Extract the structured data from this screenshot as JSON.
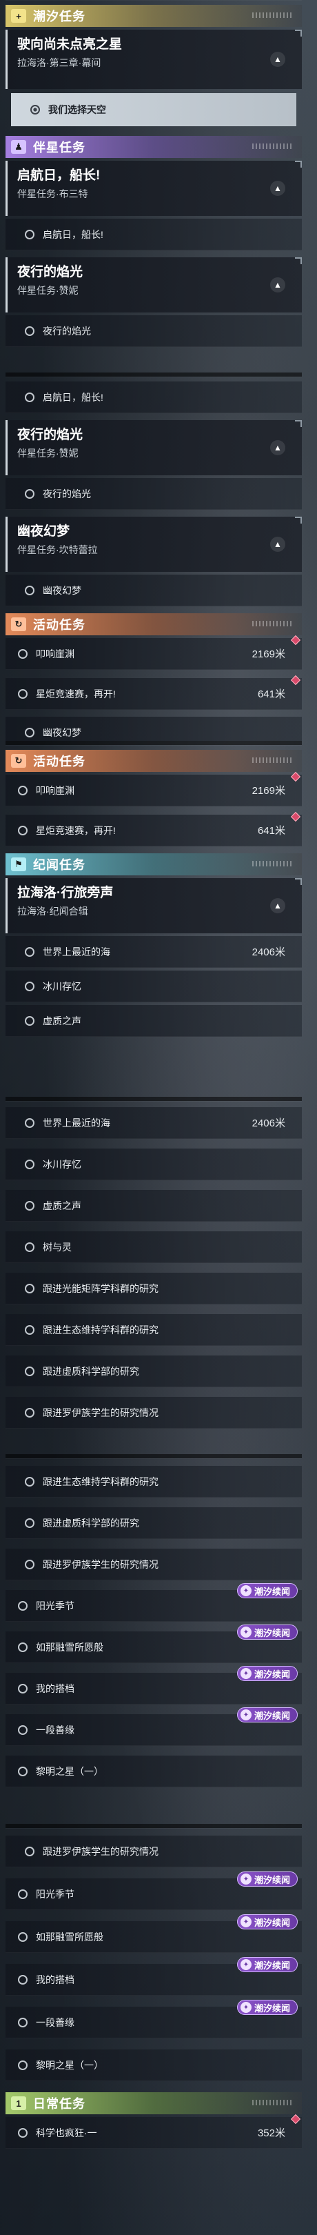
{
  "shots": {
    "s1": {
      "cat_chaoxi": {
        "title": "潮汐任务",
        "icon": "plus-icon",
        "badge": "+"
      },
      "quest_main": {
        "name": "驶向尚未点亮之星",
        "sub": "拉海洛·第三章·幕间"
      },
      "sub_main": "我们选择天空",
      "cat_banxing": {
        "title": "伴星任务",
        "icon": "person-icon",
        "badge": "♟"
      },
      "q_qihang": {
        "name": "启航日，船长!",
        "sub": "伴星任务·布三特"
      },
      "s_qihang": "启航日，船长!",
      "q_yexing": {
        "name": "夜行的焰光",
        "sub": "伴星任务·赞妮"
      },
      "s_yexing": "夜行的焰光"
    },
    "s2": {
      "s_qihang": "启航日，船长!",
      "q_yexing": {
        "name": "夜行的焰光",
        "sub": "伴星任务·赞妮"
      },
      "s_yexing": "夜行的焰光",
      "q_youye": {
        "name": "幽夜幻梦",
        "sub": "伴星任务·坎特蕾拉"
      },
      "s_youye": "幽夜幻梦",
      "cat_huodong": {
        "title": "活动任务",
        "icon": "refresh-icon",
        "badge": "↻"
      },
      "s_jixiang": {
        "label": "叩响崖渊",
        "dist": "2169米"
      },
      "s_xingju": {
        "label": "星炬竞速赛，再开!",
        "dist": "641米"
      },
      "s_youye2": "幽夜幻梦"
    },
    "s3": {
      "cat_huodong": {
        "title": "活动任务",
        "icon": "refresh-icon",
        "badge": "↻"
      },
      "s_jixiang": {
        "label": "叩响崖渊",
        "dist": "2169米"
      },
      "s_xingju": {
        "label": "星炬竞速赛，再开!",
        "dist": "641米"
      },
      "cat_jiwen": {
        "title": "纪闻任务",
        "icon": "flag-icon",
        "badge": "⚑"
      },
      "q_lahai": {
        "name": "拉海洛·行旅旁声",
        "sub": "拉海洛·纪闻合辑"
      },
      "s_shijie": {
        "label": "世界上最近的海",
        "dist": "2406米"
      },
      "s_bingchuan": "冰川存忆",
      "s_xuzhi": "虚质之声"
    },
    "s4": {
      "s_shijie": {
        "label": "世界上最近的海",
        "dist": "2406米"
      },
      "s_bingchuan": "冰川存忆",
      "s_xuzhi": "虚质之声",
      "s_shu": "树与灵",
      "s_g1": "跟进光能矩阵学科群的研究",
      "s_g2": "跟进生态维持学科群的研究",
      "s_g3": "跟进虚质科学部的研究",
      "s_g4": "跟进罗伊族学生的研究情况"
    },
    "s5": {
      "s_g2": "跟进生态维持学科群的研究",
      "s_g3": "跟进虚质科学部的研究",
      "s_g4": "跟进罗伊族学生的研究情况",
      "s_yang": "阳光季节",
      "s_ru": "如那融雪所愿般",
      "s_wo": "我的搭档",
      "s_yi": "一段善缘",
      "s_li": "黎明之星（一）",
      "tag": "潮汐续闻"
    },
    "s6": {
      "s_g4": "跟进罗伊族学生的研究情况",
      "s_yang": "阳光季节",
      "s_ru": "如那融雪所愿般",
      "s_wo": "我的搭档",
      "s_yi": "一段善缘",
      "s_li": "黎明之星（一）",
      "cat_richang": {
        "title": "日常任务",
        "icon": "daily-icon",
        "badge": "1"
      },
      "s_ke": {
        "label": "科学也疯狂·一",
        "dist": "352米"
      },
      "tag": "潮汐续闻"
    }
  },
  "colors": {
    "yellow": "#d8c66a",
    "purple": "#a57fe0",
    "orange": "#e38a5a",
    "teal": "#6fc0cf",
    "green": "#a4c96b",
    "tag": "#8a53c9"
  }
}
